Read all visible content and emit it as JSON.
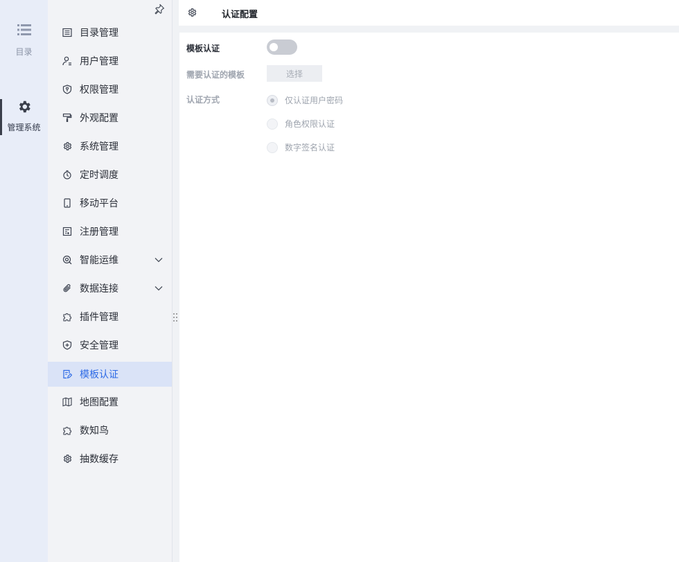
{
  "rail": {
    "items": [
      {
        "label": "目录",
        "icon": "list-icon"
      },
      {
        "label": "管理系统",
        "icon": "gear-icon"
      }
    ]
  },
  "menu": {
    "items": [
      {
        "label": "目录管理",
        "icon": "catalog-icon"
      },
      {
        "label": "用户管理",
        "icon": "user-icon"
      },
      {
        "label": "权限管理",
        "icon": "shield-key-icon"
      },
      {
        "label": "外观配置",
        "icon": "paint-roller-icon"
      },
      {
        "label": "系统管理",
        "icon": "gear-icon"
      },
      {
        "label": "定时调度",
        "icon": "timer-icon"
      },
      {
        "label": "移动平台",
        "icon": "mobile-icon"
      },
      {
        "label": "注册管理",
        "icon": "register-icon"
      },
      {
        "label": "智能运维",
        "icon": "ops-icon",
        "expandable": true
      },
      {
        "label": "数据连接",
        "icon": "paperclip-icon",
        "expandable": true
      },
      {
        "label": "插件管理",
        "icon": "puzzle-icon"
      },
      {
        "label": "安全管理",
        "icon": "shield-plus-icon"
      },
      {
        "label": "模板认证",
        "icon": "template-auth-icon",
        "active": true
      },
      {
        "label": "地图配置",
        "icon": "map-icon"
      },
      {
        "label": "数知鸟",
        "icon": "puzzle-icon"
      },
      {
        "label": "抽数缓存",
        "icon": "gear-icon"
      }
    ]
  },
  "header": {
    "title": "认证配置",
    "icon": "gear-icon"
  },
  "form": {
    "template_auth_label": "模板认证",
    "template_auth_enabled": false,
    "templates_label": "需要认证的模板",
    "select_button": "选择",
    "auth_method_label": "认证方式",
    "auth_methods": [
      {
        "label": "仅认证用户密码",
        "checked": true
      },
      {
        "label": "角色权限认证",
        "checked": false
      },
      {
        "label": "数字签名认证",
        "checked": false
      }
    ]
  },
  "colors": {
    "accent": "#2e6be6",
    "active_bg": "#dae3f7",
    "rail_bg": "#e8edf8",
    "menu_bg": "#f2f3f6"
  }
}
